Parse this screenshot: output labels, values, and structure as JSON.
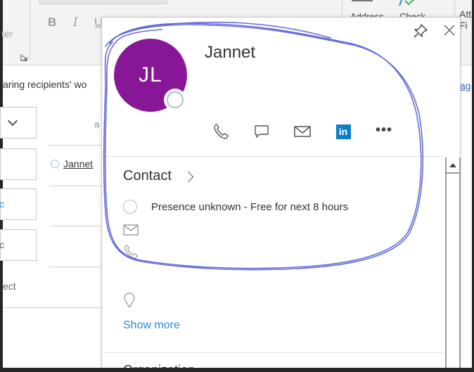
{
  "ribbon": {
    "left_group_fragment": "ter",
    "format_buttons": [
      "B",
      "I",
      "U"
    ],
    "address_label": "Address",
    "check_label": "Check",
    "attach_label_1": "Att",
    "attach_label_2": "Fi"
  },
  "compose": {
    "info_bar_text": "aring recipients' wo",
    "info_bar_link": "ag",
    "recipient_name": "Jannet",
    "subject_fragment": "ect",
    "to_field_fragment": "a",
    "cc_fragment": "c",
    "bcc_fragment": "c"
  },
  "contact_card": {
    "initials": "JL",
    "name": "Jannet",
    "avatar_color": "#881798",
    "actions": [
      {
        "icon": "phone-icon",
        "label": "Call"
      },
      {
        "icon": "chat-icon",
        "label": "Chat"
      },
      {
        "icon": "mail-icon",
        "label": "Email"
      },
      {
        "icon": "linkedin-icon",
        "label": "LinkedIn",
        "glyph": "in"
      },
      {
        "icon": "more-icon",
        "label": "More",
        "glyph": "•••"
      }
    ],
    "section_title": "Contact",
    "presence_text": "Presence unknown - Free for next 8 hours",
    "show_more_label": "Show more",
    "next_section_fragment": "Organization"
  },
  "colors": {
    "accent_link": "#2b88d8",
    "linkedin": "#0a7fc4",
    "annotation_ink": "#4a52d0"
  }
}
